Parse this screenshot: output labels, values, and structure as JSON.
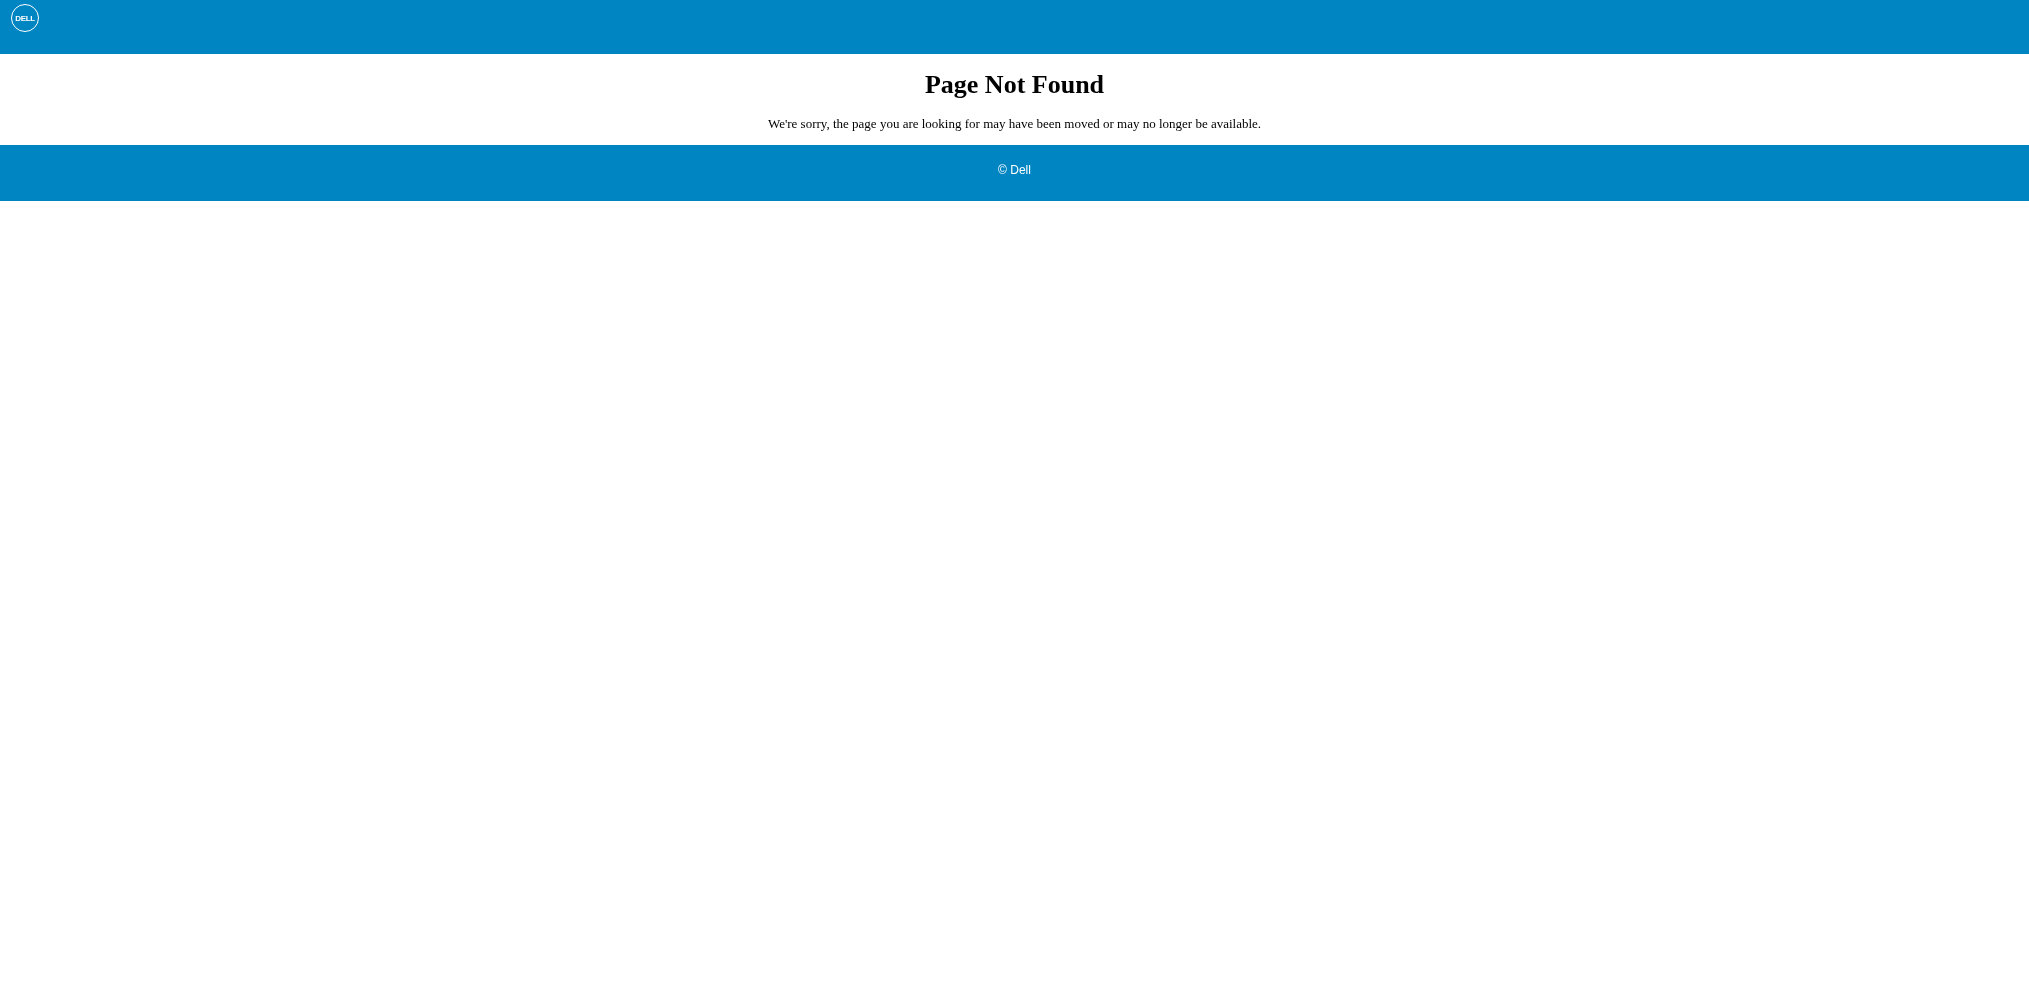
{
  "header": {
    "logo": "DELL"
  },
  "main": {
    "title": "Page Not Found",
    "message": "We're sorry, the page you are looking for may have been moved or may no longer be available."
  },
  "footer": {
    "copyright": "© Dell"
  }
}
